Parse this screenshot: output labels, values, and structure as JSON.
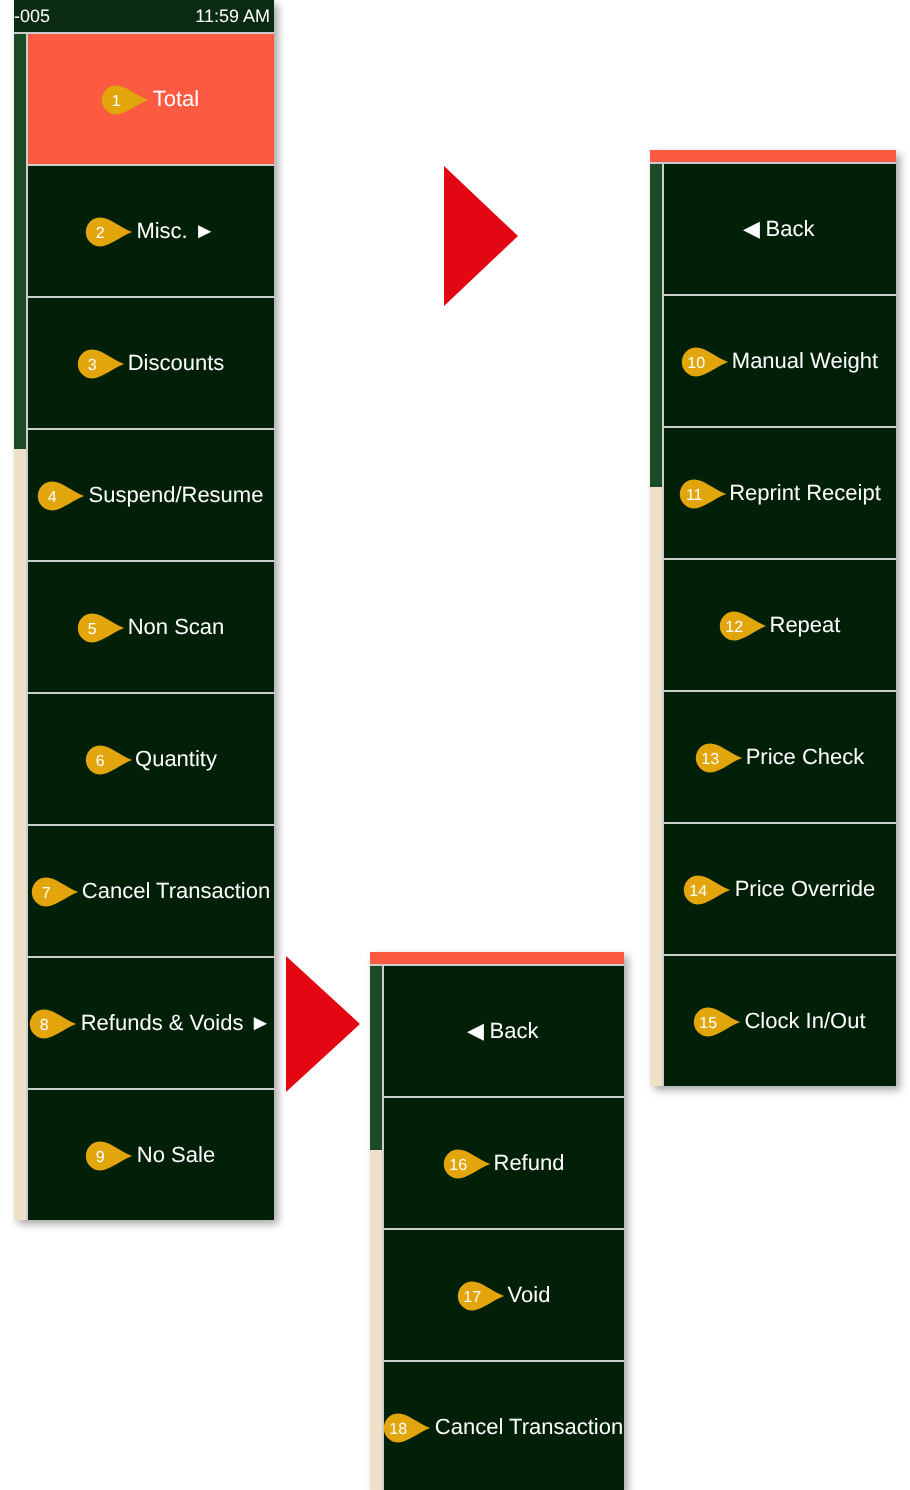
{
  "status_bar": {
    "terminal": "-005",
    "time": "11:59 AM"
  },
  "main_menu": {
    "buttons": [
      {
        "callout": "1",
        "label": "Total",
        "highlighted": true
      },
      {
        "callout": "2",
        "label": "Misc. ►",
        "highlighted": false
      },
      {
        "callout": "3",
        "label": "Discounts",
        "highlighted": false
      },
      {
        "callout": "4",
        "label": "Suspend/Resume",
        "highlighted": false
      },
      {
        "callout": "5",
        "label": "Non Scan",
        "highlighted": false
      },
      {
        "callout": "6",
        "label": "Quantity",
        "highlighted": false
      },
      {
        "callout": "7",
        "label": "Cancel Transaction",
        "highlighted": false
      },
      {
        "callout": "8",
        "label": "Refunds & Voids ►",
        "highlighted": false
      },
      {
        "callout": "9",
        "label": "No Sale",
        "highlighted": false
      }
    ]
  },
  "misc_menu": {
    "buttons": [
      {
        "label": "◀ Back",
        "highlighted": false
      },
      {
        "callout": "10",
        "label": "Manual Weight",
        "highlighted": false
      },
      {
        "callout": "11",
        "label": "Reprint Receipt",
        "highlighted": false
      },
      {
        "callout": "12",
        "label": "Repeat",
        "highlighted": false
      },
      {
        "callout": "13",
        "label": "Price Check",
        "highlighted": false
      },
      {
        "callout": "14",
        "label": "Price Override",
        "highlighted": false
      },
      {
        "callout": "15",
        "label": "Clock In/Out",
        "highlighted": false
      }
    ]
  },
  "refunds_menu": {
    "buttons": [
      {
        "label": "◀ Back",
        "highlighted": false
      },
      {
        "callout": "16",
        "label": "Refund",
        "highlighted": false
      },
      {
        "callout": "17",
        "label": "Void",
        "highlighted": false
      },
      {
        "callout": "18",
        "label": "Cancel Transaction",
        "highlighted": false
      }
    ]
  }
}
